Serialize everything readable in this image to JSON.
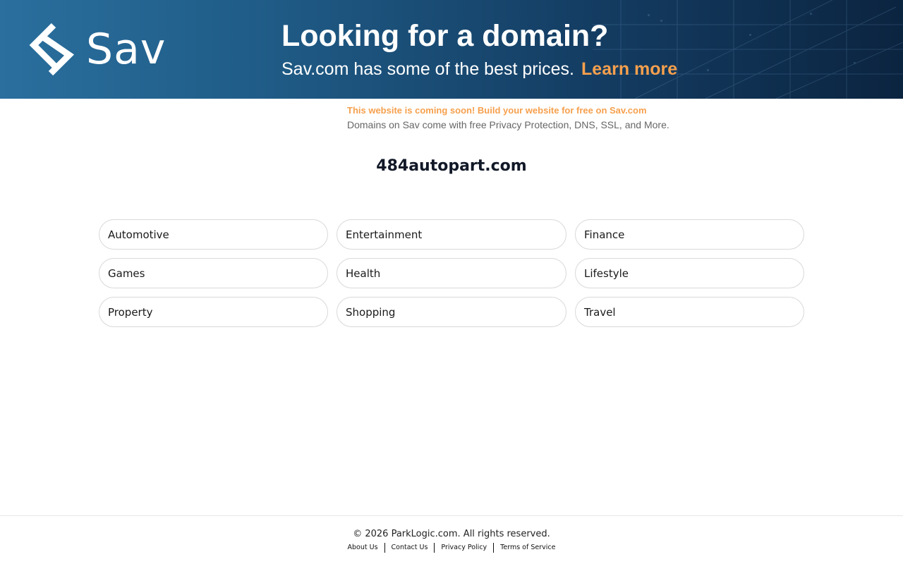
{
  "banner": {
    "logo_text": "Sav",
    "headline": "Looking for a domain?",
    "subline": "Sav.com has some of the best prices.",
    "cta": "Learn more",
    "logo_icon": "sav-logo-icon",
    "cta_color": "#f6a04d"
  },
  "notice": {
    "line1": "This website is coming soon! Build your website for free on Sav.com",
    "line2": "Domains on Sav come with free Privacy Protection, DNS, SSL, and More."
  },
  "domain": "484autopart.com",
  "categories": [
    "Automotive",
    "Entertainment",
    "Finance",
    "Games",
    "Health",
    "Lifestyle",
    "Property",
    "Shopping",
    "Travel"
  ],
  "footer": {
    "copyright": "© 2026 ParkLogic.com. All rights reserved.",
    "links": [
      "About Us",
      "Contact Us",
      "Privacy Policy",
      "Terms of Service"
    ]
  }
}
